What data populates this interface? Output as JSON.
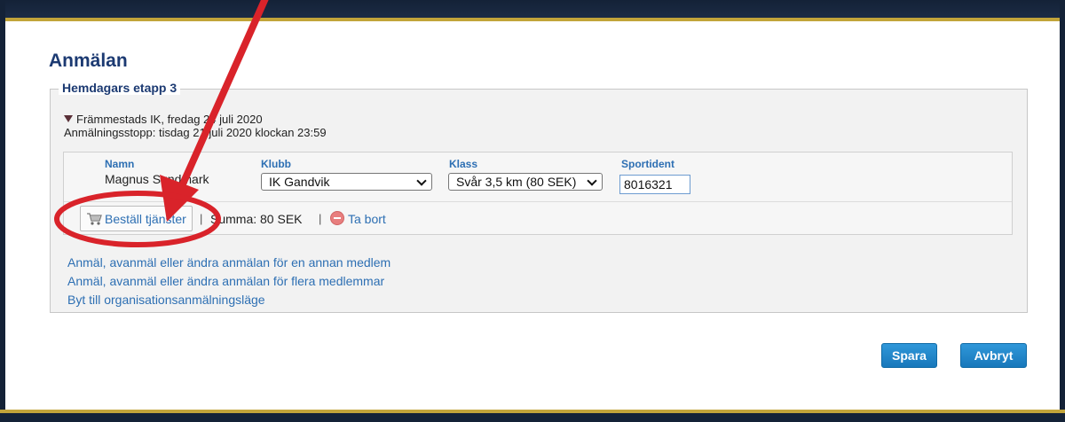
{
  "page": {
    "title": "Anmälan"
  },
  "event": {
    "name": "Hemdagars etapp 3",
    "organizer_date": "Främmestads IK, fredag 24 juli 2020",
    "deadline": "Anmälningsstopp: tisdag 21 juli 2020 klockan 23:59"
  },
  "entry": {
    "headers": {
      "name": "Namn",
      "club": "Klubb",
      "class": "Klass",
      "sportident": "Sportident"
    },
    "name": "Magnus Sundmark",
    "club": "IK Gandvik",
    "class": "Svår 3,5 km (80 SEK)",
    "sportident": "8016321"
  },
  "actions": {
    "services_label": "Beställ tjänster",
    "separator": "|",
    "sum": "Summa: 80 SEK",
    "remove_label": "Ta bort"
  },
  "links": [
    "Anmäl, avanmäl eller ändra anmälan för en annan medlem",
    "Anmäl, avanmäl eller ändra anmälan för flera medlemmar",
    "Byt till organisationsanmälningsläge"
  ],
  "buttons": {
    "save": "Spara",
    "cancel": "Avbryt"
  },
  "icons": {
    "cart": "cart-icon",
    "remove": "remove-icon",
    "expand": "triangle-down-icon"
  },
  "colors": {
    "link": "#2d6fb3",
    "title": "#1c3a72",
    "button": "#1e80c4",
    "annotation": "#d9232a",
    "frame_gold": "#c2a43a"
  }
}
